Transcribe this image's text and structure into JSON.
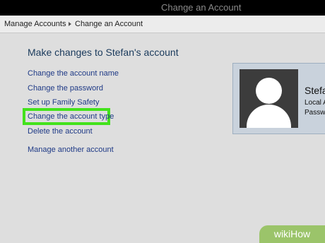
{
  "window": {
    "title": "Change an Account"
  },
  "breadcrumb": {
    "items": [
      "Manage Accounts",
      "Change an Account"
    ]
  },
  "main": {
    "heading": "Make changes to Stefan's account",
    "links": {
      "change_name": "Change the account name",
      "change_password": "Change the password",
      "family_safety": "Set up Family Safety",
      "change_type": "Change the account type",
      "delete": "Delete the account",
      "manage_another": "Manage another account"
    }
  },
  "account_card": {
    "name": "Stefa",
    "type": "Local A",
    "password": "Passw"
  },
  "watermark": {
    "text": "wikiHow"
  },
  "colors": {
    "highlight": "#43e21c",
    "link": "#1f3a86",
    "heading": "#1a3a5c"
  }
}
